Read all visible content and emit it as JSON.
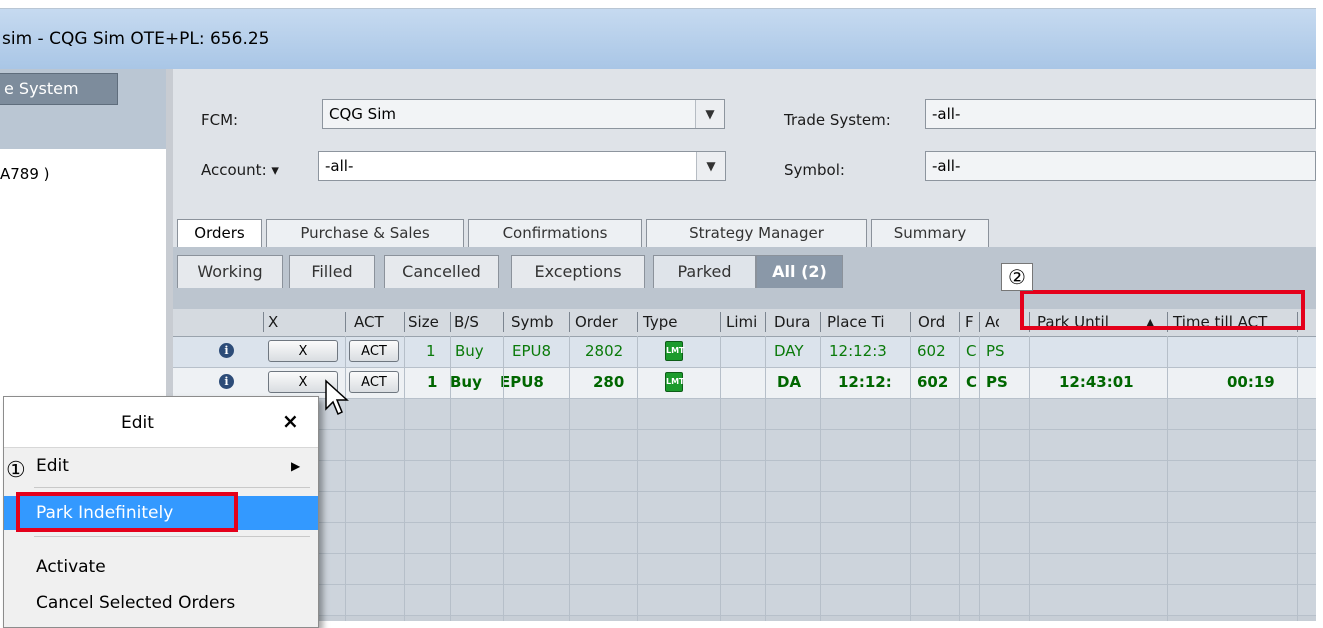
{
  "window": {
    "title": "sim - CQG Sim OTE+PL: 656.25"
  },
  "left_panel": {
    "tab_label": "e System",
    "account_text": "A789 )"
  },
  "filters": {
    "fcm_label": "FCM:",
    "fcm_value": "CQG Sim",
    "account_label": "Account: ▾",
    "account_value": "-all-",
    "trade_system_label": "Trade System:",
    "trade_system_value": "-all-",
    "symbol_label": "Symbol:",
    "symbol_value": "-all-"
  },
  "main_tabs": [
    "Orders",
    "Purchase & Sales",
    "Confirmations",
    "Strategy Manager",
    "Summary"
  ],
  "sub_tabs": [
    "Working",
    "Filled",
    "Cancelled",
    "Exceptions",
    "Parked",
    "All (2)"
  ],
  "columns": [
    "X",
    "ACT",
    "Size",
    "B/S",
    "Symb",
    "Order",
    "Type",
    "Limi",
    "Dura",
    "Place Ti",
    "Ord",
    "F",
    "Ac",
    "Park Until",
    "Time till ACT"
  ],
  "sort_icon": "sort-ascending-icon",
  "rows": [
    {
      "x": "X",
      "act": "ACT",
      "size": "1",
      "bs": "Buy",
      "symb": "EPU8",
      "order": "2802",
      "type": "LMT",
      "limit": "",
      "dura": "DAY",
      "place": "12:12:3",
      "ord": "602",
      "f": "C",
      "ac": "PS",
      "park_until": "",
      "time_till": ""
    },
    {
      "x": "X",
      "act": "ACT",
      "size": "1",
      "bs": "Buy",
      "symb": "EPU8",
      "order": "280",
      "type": "LMT",
      "limit": "",
      "dura": "DA",
      "place": "12:12:",
      "ord": "602",
      "f": "C",
      "ac": "PS",
      "park_until": "12:43:01",
      "time_till": "00:19"
    }
  ],
  "context_menu": {
    "title": "Edit",
    "close": "×",
    "items": [
      "Edit",
      "Park Indefinitely",
      "Activate",
      "Cancel Selected Orders"
    ],
    "submenu_arrow": "▶"
  },
  "callouts": {
    "one": "①",
    "two": "②"
  },
  "colors": {
    "highlight": "#e4001b",
    "menu_selected": "#3399ff",
    "order_text": "#006600"
  }
}
